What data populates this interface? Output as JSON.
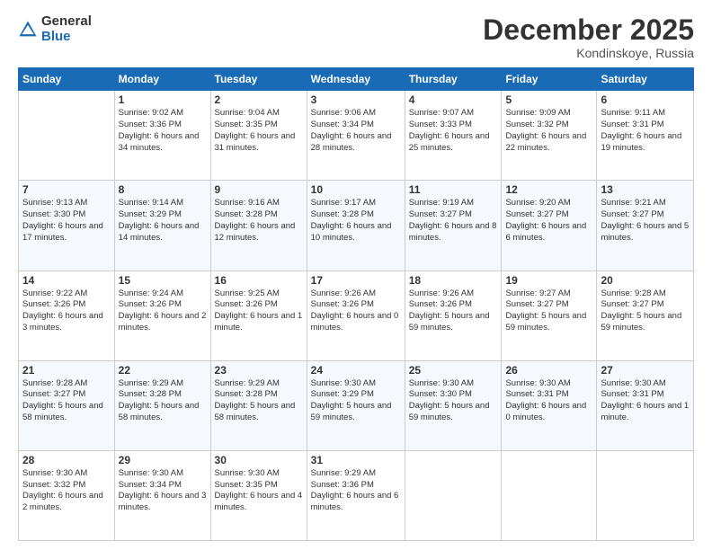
{
  "header": {
    "logo_general": "General",
    "logo_blue": "Blue",
    "month": "December 2025",
    "location": "Kondinskoye, Russia"
  },
  "weekdays": [
    "Sunday",
    "Monday",
    "Tuesday",
    "Wednesday",
    "Thursday",
    "Friday",
    "Saturday"
  ],
  "weeks": [
    [
      {
        "day": "",
        "sunrise": "",
        "sunset": "",
        "daylight": ""
      },
      {
        "day": "1",
        "sunrise": "Sunrise: 9:02 AM",
        "sunset": "Sunset: 3:36 PM",
        "daylight": "Daylight: 6 hours and 34 minutes."
      },
      {
        "day": "2",
        "sunrise": "Sunrise: 9:04 AM",
        "sunset": "Sunset: 3:35 PM",
        "daylight": "Daylight: 6 hours and 31 minutes."
      },
      {
        "day": "3",
        "sunrise": "Sunrise: 9:06 AM",
        "sunset": "Sunset: 3:34 PM",
        "daylight": "Daylight: 6 hours and 28 minutes."
      },
      {
        "day": "4",
        "sunrise": "Sunrise: 9:07 AM",
        "sunset": "Sunset: 3:33 PM",
        "daylight": "Daylight: 6 hours and 25 minutes."
      },
      {
        "day": "5",
        "sunrise": "Sunrise: 9:09 AM",
        "sunset": "Sunset: 3:32 PM",
        "daylight": "Daylight: 6 hours and 22 minutes."
      },
      {
        "day": "6",
        "sunrise": "Sunrise: 9:11 AM",
        "sunset": "Sunset: 3:31 PM",
        "daylight": "Daylight: 6 hours and 19 minutes."
      }
    ],
    [
      {
        "day": "7",
        "sunrise": "Sunrise: 9:13 AM",
        "sunset": "Sunset: 3:30 PM",
        "daylight": "Daylight: 6 hours and 17 minutes."
      },
      {
        "day": "8",
        "sunrise": "Sunrise: 9:14 AM",
        "sunset": "Sunset: 3:29 PM",
        "daylight": "Daylight: 6 hours and 14 minutes."
      },
      {
        "day": "9",
        "sunrise": "Sunrise: 9:16 AM",
        "sunset": "Sunset: 3:28 PM",
        "daylight": "Daylight: 6 hours and 12 minutes."
      },
      {
        "day": "10",
        "sunrise": "Sunrise: 9:17 AM",
        "sunset": "Sunset: 3:28 PM",
        "daylight": "Daylight: 6 hours and 10 minutes."
      },
      {
        "day": "11",
        "sunrise": "Sunrise: 9:19 AM",
        "sunset": "Sunset: 3:27 PM",
        "daylight": "Daylight: 6 hours and 8 minutes."
      },
      {
        "day": "12",
        "sunrise": "Sunrise: 9:20 AM",
        "sunset": "Sunset: 3:27 PM",
        "daylight": "Daylight: 6 hours and 6 minutes."
      },
      {
        "day": "13",
        "sunrise": "Sunrise: 9:21 AM",
        "sunset": "Sunset: 3:27 PM",
        "daylight": "Daylight: 6 hours and 5 minutes."
      }
    ],
    [
      {
        "day": "14",
        "sunrise": "Sunrise: 9:22 AM",
        "sunset": "Sunset: 3:26 PM",
        "daylight": "Daylight: 6 hours and 3 minutes."
      },
      {
        "day": "15",
        "sunrise": "Sunrise: 9:24 AM",
        "sunset": "Sunset: 3:26 PM",
        "daylight": "Daylight: 6 hours and 2 minutes."
      },
      {
        "day": "16",
        "sunrise": "Sunrise: 9:25 AM",
        "sunset": "Sunset: 3:26 PM",
        "daylight": "Daylight: 6 hours and 1 minute."
      },
      {
        "day": "17",
        "sunrise": "Sunrise: 9:26 AM",
        "sunset": "Sunset: 3:26 PM",
        "daylight": "Daylight: 6 hours and 0 minutes."
      },
      {
        "day": "18",
        "sunrise": "Sunrise: 9:26 AM",
        "sunset": "Sunset: 3:26 PM",
        "daylight": "Daylight: 5 hours and 59 minutes."
      },
      {
        "day": "19",
        "sunrise": "Sunrise: 9:27 AM",
        "sunset": "Sunset: 3:27 PM",
        "daylight": "Daylight: 5 hours and 59 minutes."
      },
      {
        "day": "20",
        "sunrise": "Sunrise: 9:28 AM",
        "sunset": "Sunset: 3:27 PM",
        "daylight": "Daylight: 5 hours and 59 minutes."
      }
    ],
    [
      {
        "day": "21",
        "sunrise": "Sunrise: 9:28 AM",
        "sunset": "Sunset: 3:27 PM",
        "daylight": "Daylight: 5 hours and 58 minutes."
      },
      {
        "day": "22",
        "sunrise": "Sunrise: 9:29 AM",
        "sunset": "Sunset: 3:28 PM",
        "daylight": "Daylight: 5 hours and 58 minutes."
      },
      {
        "day": "23",
        "sunrise": "Sunrise: 9:29 AM",
        "sunset": "Sunset: 3:28 PM",
        "daylight": "Daylight: 5 hours and 58 minutes."
      },
      {
        "day": "24",
        "sunrise": "Sunrise: 9:30 AM",
        "sunset": "Sunset: 3:29 PM",
        "daylight": "Daylight: 5 hours and 59 minutes."
      },
      {
        "day": "25",
        "sunrise": "Sunrise: 9:30 AM",
        "sunset": "Sunset: 3:30 PM",
        "daylight": "Daylight: 5 hours and 59 minutes."
      },
      {
        "day": "26",
        "sunrise": "Sunrise: 9:30 AM",
        "sunset": "Sunset: 3:31 PM",
        "daylight": "Daylight: 6 hours and 0 minutes."
      },
      {
        "day": "27",
        "sunrise": "Sunrise: 9:30 AM",
        "sunset": "Sunset: 3:31 PM",
        "daylight": "Daylight: 6 hours and 1 minute."
      }
    ],
    [
      {
        "day": "28",
        "sunrise": "Sunrise: 9:30 AM",
        "sunset": "Sunset: 3:32 PM",
        "daylight": "Daylight: 6 hours and 2 minutes."
      },
      {
        "day": "29",
        "sunrise": "Sunrise: 9:30 AM",
        "sunset": "Sunset: 3:34 PM",
        "daylight": "Daylight: 6 hours and 3 minutes."
      },
      {
        "day": "30",
        "sunrise": "Sunrise: 9:30 AM",
        "sunset": "Sunset: 3:35 PM",
        "daylight": "Daylight: 6 hours and 4 minutes."
      },
      {
        "day": "31",
        "sunrise": "Sunrise: 9:29 AM",
        "sunset": "Sunset: 3:36 PM",
        "daylight": "Daylight: 6 hours and 6 minutes."
      },
      {
        "day": "",
        "sunrise": "",
        "sunset": "",
        "daylight": ""
      },
      {
        "day": "",
        "sunrise": "",
        "sunset": "",
        "daylight": ""
      },
      {
        "day": "",
        "sunrise": "",
        "sunset": "",
        "daylight": ""
      }
    ]
  ]
}
